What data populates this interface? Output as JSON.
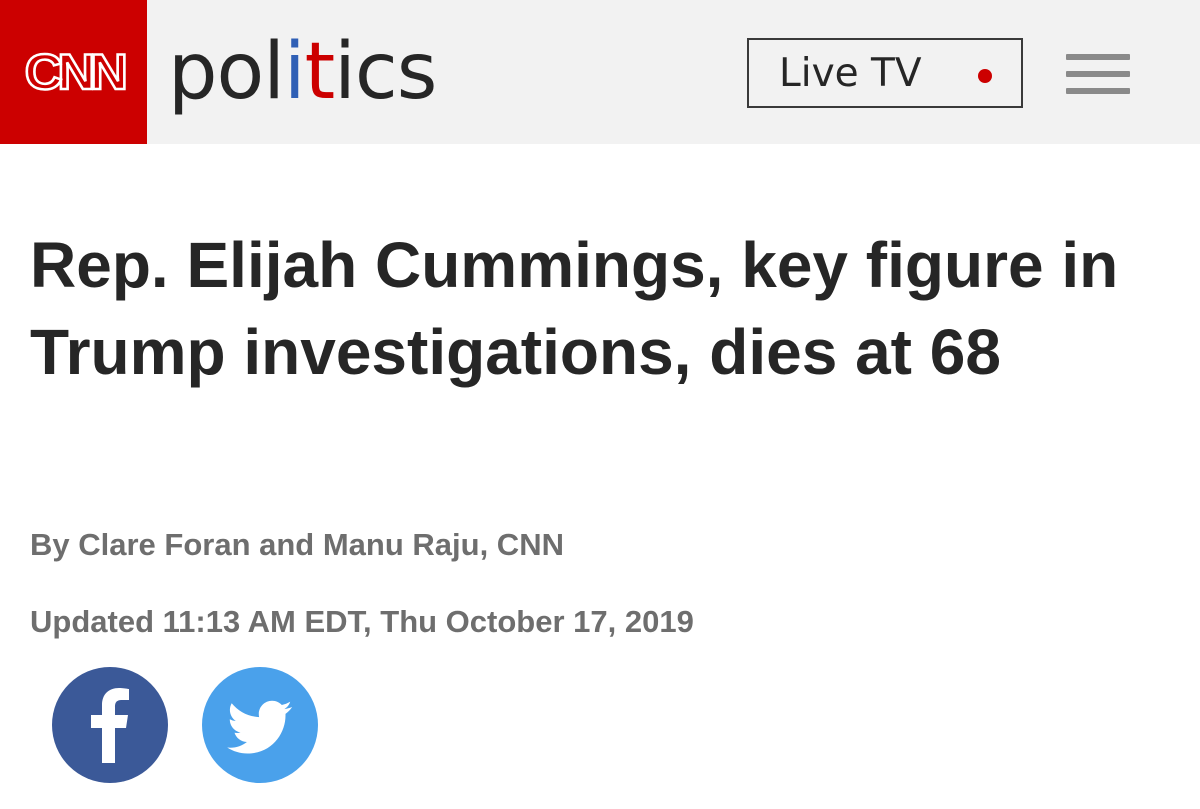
{
  "header": {
    "logo_text": "CNN",
    "section_parts": [
      "pol",
      "i",
      "t",
      "ics"
    ],
    "live_tv_label": "Live TV",
    "menu_icon": "hamburger-menu-icon"
  },
  "article": {
    "headline": "Rep. Elijah Cummings, key figure in Trump investigations, dies at 68",
    "byline": "By Clare Foran and Manu Raju, CNN",
    "updated": "Updated 11:13 AM EDT, Thu October 17, 2019"
  },
  "share": {
    "facebook_icon": "facebook-icon",
    "twitter_icon": "twitter-icon"
  },
  "colors": {
    "brand_red": "#cc0000",
    "header_bg": "#f2f2f2",
    "politics_blue": "#2f5fb5",
    "facebook": "#3b5998",
    "twitter": "#4aa1eb",
    "meta_gray": "#6e6e6e"
  }
}
